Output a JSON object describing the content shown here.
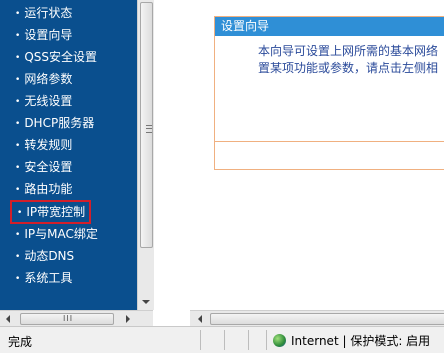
{
  "nav": {
    "items": [
      {
        "label": "运行状态"
      },
      {
        "label": "设置向导"
      },
      {
        "label": "QSS安全设置"
      },
      {
        "label": "网络参数"
      },
      {
        "label": "无线设置"
      },
      {
        "label": "DHCP服务器"
      },
      {
        "label": "转发规则"
      },
      {
        "label": "安全设置"
      },
      {
        "label": "路由功能"
      },
      {
        "label": "IP带宽控制",
        "highlighted": true
      },
      {
        "label": "IP与MAC绑定"
      },
      {
        "label": "动态DNS"
      },
      {
        "label": "系统工具"
      }
    ],
    "bullet": "•",
    "hscroll_grip": "III"
  },
  "panel": {
    "title": "设置向导",
    "line1": "本向导可设置上网所需的基本网络",
    "line2": "置某项功能或参数，请点击左侧相"
  },
  "statusbar": {
    "status": "完成",
    "zone": "Internet | 保护模式: 启用"
  },
  "colors": {
    "nav_bg": "#0a4f8e",
    "highlight_border": "#d21f2a",
    "panel_header": "#2f8fd6",
    "panel_border": "#f0b080",
    "panel_text": "#2a4a9a"
  }
}
